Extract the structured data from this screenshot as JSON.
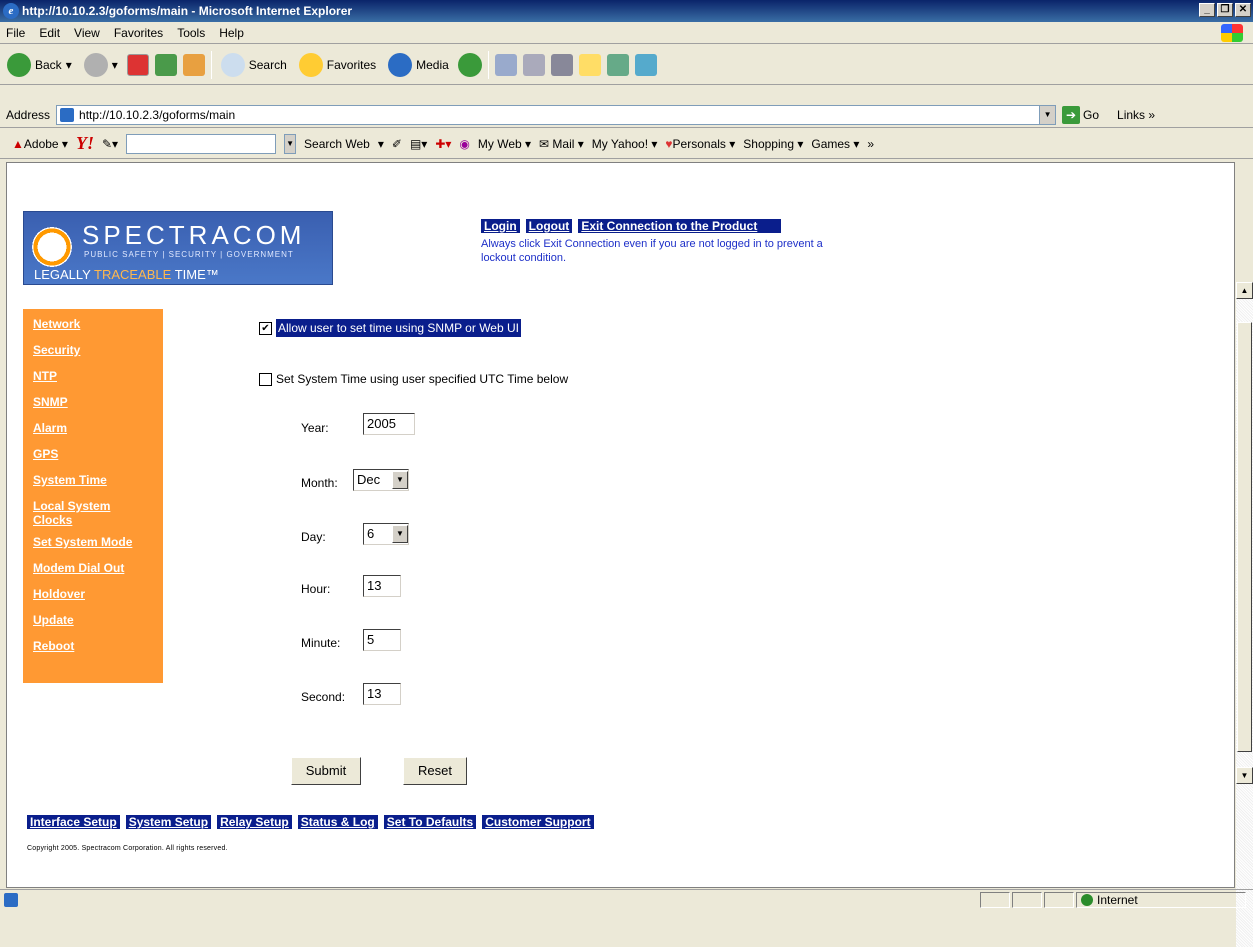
{
  "window": {
    "title": "http://10.10.2.3/goforms/main - Microsoft Internet Explorer"
  },
  "menu": [
    "File",
    "Edit",
    "View",
    "Favorites",
    "Tools",
    "Help"
  ],
  "toolbar": {
    "back": "Back",
    "search": "Search",
    "favorites": "Favorites",
    "media": "Media"
  },
  "address": {
    "label": "Address",
    "url": "http://10.10.2.3/goforms/main",
    "go": "Go",
    "links": "Links"
  },
  "yahoo_bar": {
    "adobe": "Adobe",
    "search_web": "Search Web",
    "my_web": "My Web",
    "mail": "Mail",
    "my_yahoo": "My Yahoo!",
    "personals": "Personals",
    "shopping": "Shopping",
    "games": "Games"
  },
  "logo": {
    "name": "SPECTRACOM",
    "sub": "PUBLIC SAFETY | SECURITY | GOVERNMENT",
    "tag1": "LEGALLY ",
    "tag2": "TRACEABLE",
    "tag3": " TIME™"
  },
  "top_links": {
    "login": "Login",
    "logout": "Logout",
    "exit": "Exit Connection to the Product"
  },
  "warning": "Always click Exit Connection even if you are not logged in to prevent a lockout condition.",
  "sidenav": [
    "Network",
    "Security",
    "NTP",
    "SNMP",
    "Alarm",
    "GPS",
    "System Time",
    "Local System Clocks",
    "Set System Mode",
    "Modem Dial Out",
    "Holdover",
    "Update",
    "Reboot"
  ],
  "form": {
    "allow_label": "Allow user to set time using SNMP or Web UI",
    "allow_checked": true,
    "set_label": "Set System Time using user specified UTC Time below",
    "set_checked": false,
    "year_label": "Year:",
    "year": "2005",
    "month_label": "Month:",
    "month": "Dec",
    "day_label": "Day:",
    "day": "6",
    "hour_label": "Hour:",
    "hour": "13",
    "minute_label": "Minute:",
    "minute": "5",
    "second_label": "Second:",
    "second": "13",
    "submit": "Submit",
    "reset": "Reset"
  },
  "bottom_links": [
    "Interface Setup",
    "System Setup",
    "Relay Setup",
    "Status & Log",
    "Set To Defaults",
    "Customer Support"
  ],
  "copyright": "Copyright 2005. Spectracom Corporation. All rights reserved.",
  "status": {
    "zone": "Internet"
  }
}
